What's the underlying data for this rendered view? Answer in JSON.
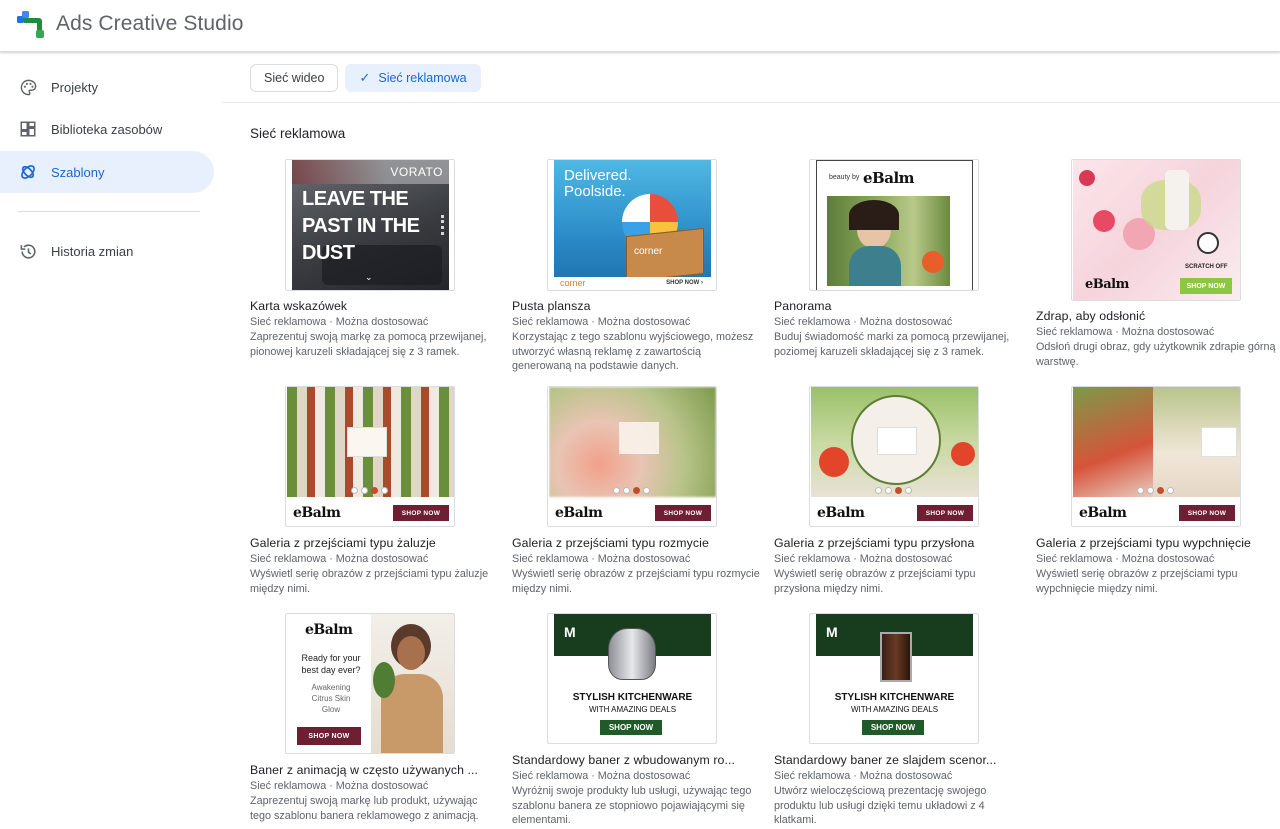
{
  "app": {
    "title": "Ads Creative Studio"
  },
  "sidebar": {
    "items": [
      {
        "label": "Projekty",
        "icon": "palette-icon"
      },
      {
        "label": "Biblioteka zasobów",
        "icon": "dashboard-icon"
      },
      {
        "label": "Szablony",
        "icon": "template-icon",
        "active": true
      },
      {
        "label": "Historia zmian",
        "icon": "history-icon"
      }
    ]
  },
  "tabs": [
    {
      "label": "Sieć wideo",
      "selected": false
    },
    {
      "label": "Sieć reklamowa",
      "selected": true
    }
  ],
  "section": {
    "title": "Sieć reklamowa"
  },
  "cards": [
    {
      "title": "Karta wskazówek",
      "meta": "Sieć reklamowa · Można dostosować",
      "desc": "Zaprezentuj swoją markę za pomocą przewijanej, pionowej karuzeli składającej się z 3 ramek.",
      "thumb": {
        "brand": "VORATO",
        "headline": "LEAVE THE PAST IN THE DUST"
      }
    },
    {
      "title": "Pusta plansza",
      "meta": "Sieć reklamowa · Można dostosować",
      "desc": "Korzystając z tego szablonu wyjściowego, możesz utworzyć własną reklamę z zawartością generowaną na podstawie danych.",
      "thumb": {
        "headline": "Delivered. Poolside.",
        "brand": "corner",
        "box_brand": "corner",
        "cta": "SHOP NOW ›"
      }
    },
    {
      "title": "Panorama",
      "meta": "Sieć reklamowa · Można dostosować",
      "desc": "Buduj świadomość marki za pomocą przewijanej, poziomej karuzeli składającej się z 3 ramek.",
      "thumb": {
        "prefix": "beauty by",
        "brand": "eBalm"
      }
    },
    {
      "title": "Zdrap, aby odsłonić",
      "meta": "Sieć reklamowa · Można dostosować",
      "desc": "Odsłoń drugi obraz, gdy użytkownik zdrapie górną warstwę.",
      "thumb": {
        "scratch": "SCRATCH OFF",
        "brand": "eBalm",
        "cta": "SHOP NOW"
      }
    },
    {
      "title": "Galeria z przejściami typu żaluzje",
      "meta": "Sieć reklamowa · Można dostosować",
      "desc": "Wyświetl serię obrazów z przejściami typu żaluzje między nimi.",
      "thumb": {
        "brand": "eBalm",
        "cta": "SHOP NOW"
      }
    },
    {
      "title": "Galeria z przejściami typu rozmycie",
      "meta": "Sieć reklamowa · Można dostosować",
      "desc": "Wyświetl serię obrazów z przejściami typu rozmycie między nimi.",
      "thumb": {
        "brand": "eBalm",
        "cta": "SHOP NOW"
      }
    },
    {
      "title": "Galeria z przejściami typu przysłona",
      "meta": "Sieć reklamowa · Można dostosować",
      "desc": "Wyświetl serię obrazów z przejściami typu przysłona między nimi.",
      "thumb": {
        "brand": "eBalm",
        "cta": "SHOP NOW"
      }
    },
    {
      "title": "Galeria z przejściami typu wypchnięcie",
      "meta": "Sieć reklamowa · Można dostosować",
      "desc": "Wyświetl serię obrazów z przejściami typu wypchnięcie między nimi.",
      "thumb": {
        "brand": "eBalm",
        "cta": "SHOP NOW"
      }
    },
    {
      "title": "Baner z animacją w często używanych ...",
      "meta": "Sieć reklamowa · Można dostosować",
      "desc": "Zaprezentuj swoją markę lub produkt, używając tego szablonu banera reklamowego z animacją.",
      "thumb": {
        "brand": "eBalm",
        "headline": "Ready for your best day ever?",
        "sub": "Awakening Citrus Skin Glow",
        "cta": "SHOP NOW"
      }
    },
    {
      "title": "Standardowy baner z wbudowanym ro...",
      "meta": "Sieć reklamowa · Można dostosować",
      "desc": "Wyróżnij swoje produkty lub usługi, używając tego szablonu banera ze stopniowo pojawiającymi się elementami.",
      "thumb": {
        "headline": "STYLISH KITCHENWARE",
        "sub": "WITH AMAZING DEALS",
        "cta": "SHOP NOW"
      }
    },
    {
      "title": "Standardowy baner ze slajdem scenor...",
      "meta": "Sieć reklamowa · Można dostosować",
      "desc": "Utwórz wieloczęściową prezentację swojego produktu lub usługi dzięki temu układowi z 4 klatkami.",
      "thumb": {
        "headline": "STYLISH KITCHENWARE",
        "sub": "WITH AMAZING DEALS",
        "cta": "SHOP NOW"
      }
    }
  ]
}
